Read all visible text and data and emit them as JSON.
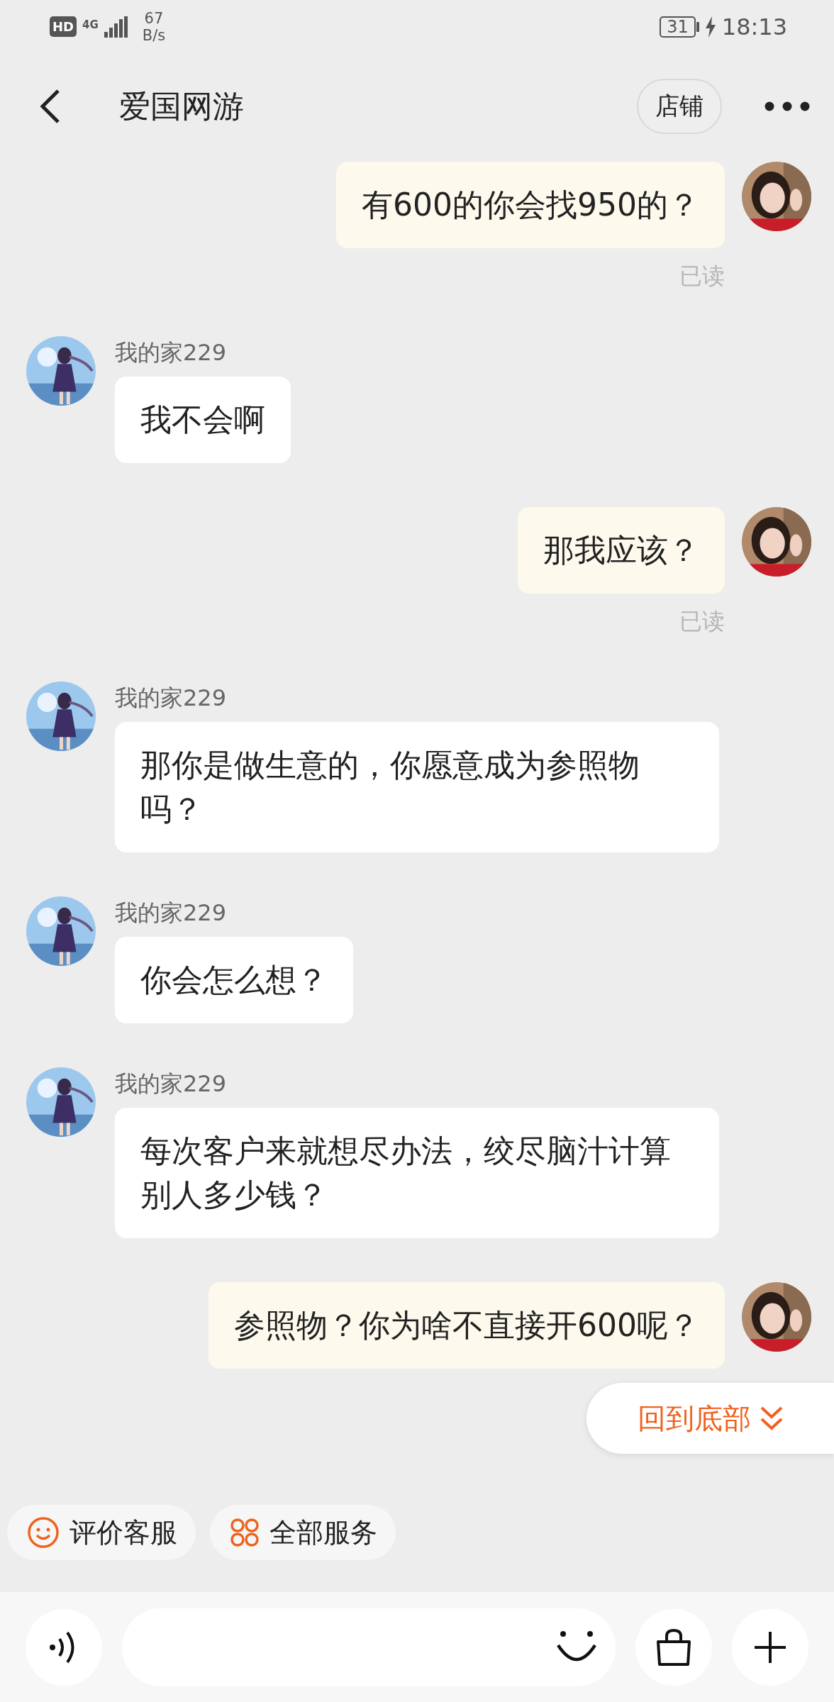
{
  "status_bar": {
    "hd": "HD",
    "network": "4G",
    "speed_value": "67",
    "speed_unit": "B/s",
    "battery": "31",
    "charging": true,
    "time": "18:13"
  },
  "header": {
    "title": "爱国网游",
    "store_button": "店铺"
  },
  "messages": [
    {
      "kind": "sent",
      "text": "有600的你会找950的？",
      "read_status": "已读"
    },
    {
      "kind": "received",
      "sender": "我的家229",
      "text": "我不会啊"
    },
    {
      "kind": "sent",
      "text": "那我应该？",
      "read_status": "已读"
    },
    {
      "kind": "received",
      "sender": "我的家229",
      "text": "那你是做生意的，你愿意成为参照物吗？"
    },
    {
      "kind": "received",
      "sender": "我的家229",
      "text": "你会怎么想？"
    },
    {
      "kind": "received",
      "sender": "我的家229",
      "text": "每次客户来就想尽办法，绞尽脑汁计算别人多少钱？"
    },
    {
      "kind": "sent",
      "text": "参照物？你为啥不直接开600呢？"
    }
  ],
  "jump_button": {
    "label": "回到底部"
  },
  "quick_actions": [
    {
      "kind": "rate",
      "label": "评价客服"
    },
    {
      "kind": "services",
      "label": "全部服务"
    }
  ]
}
